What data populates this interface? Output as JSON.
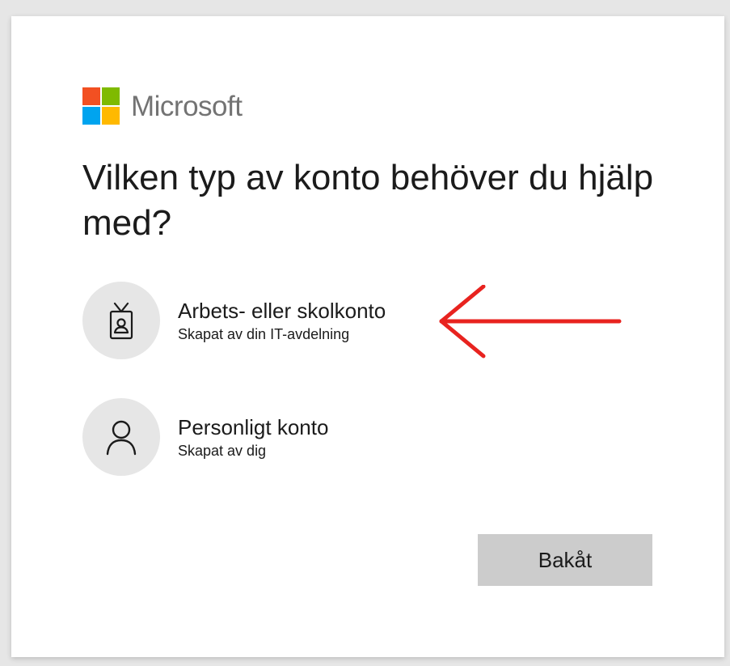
{
  "brand": {
    "name": "Microsoft",
    "logo_colors": [
      "#f25022",
      "#7fba00",
      "#00a4ef",
      "#ffb900"
    ]
  },
  "title": "Vilken typ av konto behöver du hjälp med?",
  "options": [
    {
      "icon": "badge-icon",
      "title": "Arbets- eller skolkonto",
      "subtitle": "Skapat av din IT-avdelning"
    },
    {
      "icon": "person-icon",
      "title": "Personligt konto",
      "subtitle": "Skapat av dig"
    }
  ],
  "annotation": {
    "type": "red-arrow-pointing-left",
    "color": "#e8231f"
  },
  "back_button": {
    "label": "Bakåt"
  }
}
